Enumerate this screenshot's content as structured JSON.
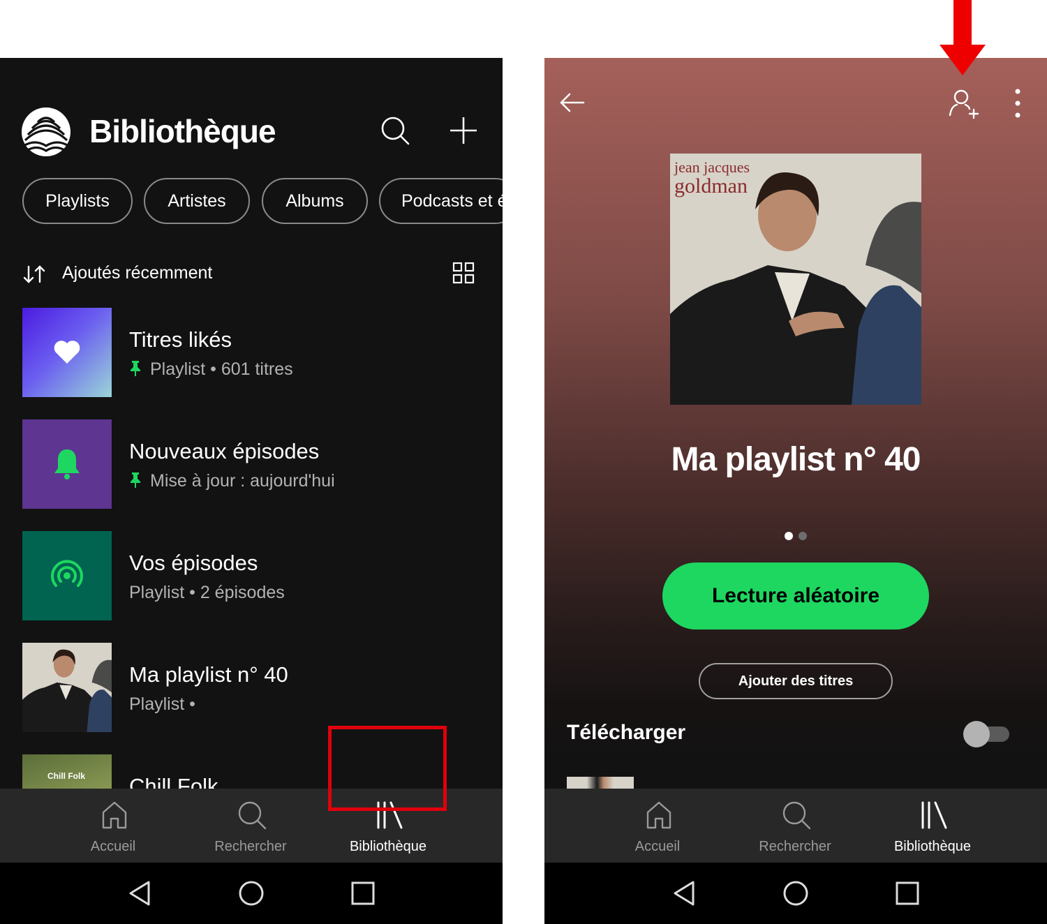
{
  "left_screen": {
    "header": {
      "title": "Bibliothèque"
    },
    "filters": [
      "Playlists",
      "Artistes",
      "Albums",
      "Podcasts et émissions"
    ],
    "sort": {
      "label": "Ajoutés récemment"
    },
    "items": [
      {
        "title": "Titres likés",
        "subtitle": "Playlist • 601 titres",
        "pinned": true
      },
      {
        "title": "Nouveaux épisodes",
        "subtitle": "Mise à jour : aujourd'hui",
        "pinned": true
      },
      {
        "title": "Vos épisodes",
        "subtitle": "Playlist • 2 épisodes",
        "pinned": false
      },
      {
        "title": "Ma playlist n° 40",
        "subtitle": "Playlist •",
        "pinned": false
      },
      {
        "title": "Chill Folk",
        "subtitle": "",
        "pinned": false,
        "thumb_text": "Chill Folk"
      }
    ],
    "bottom_nav": {
      "home": "Accueil",
      "search": "Rechercher",
      "library": "Bibliothèque",
      "active": "library"
    }
  },
  "right_screen": {
    "cover_text": {
      "line1": "jean jacques",
      "line2": "goldman"
    },
    "playlist_title": "Ma playlist n° 40",
    "shuffle_label": "Lecture aléatoire",
    "add_tracks_label": "Ajouter des titres",
    "download_label": "Télécharger",
    "download_enabled": false,
    "page_indicator": {
      "count": 2,
      "active": 1
    },
    "bottom_nav": {
      "home": "Accueil",
      "search": "Rechercher",
      "library": "Bibliothèque",
      "active": "library"
    }
  },
  "colors": {
    "spotify_green": "#1ed760",
    "background": "#121212",
    "nav_bar": "#282828",
    "highlight_red": "#e0000c",
    "header_gradient_top": "#a5605a"
  },
  "icons": [
    "library-logo-icon",
    "search-icon",
    "plus-icon",
    "sort-icon",
    "grid-view-icon",
    "heart-icon",
    "bell-icon",
    "podcast-icon",
    "pin-icon",
    "home-icon",
    "library-icon",
    "back-icon",
    "add-user-icon",
    "more-icon",
    "android-back-icon",
    "android-home-icon",
    "android-recents-icon",
    "red-arrow-icon"
  ]
}
